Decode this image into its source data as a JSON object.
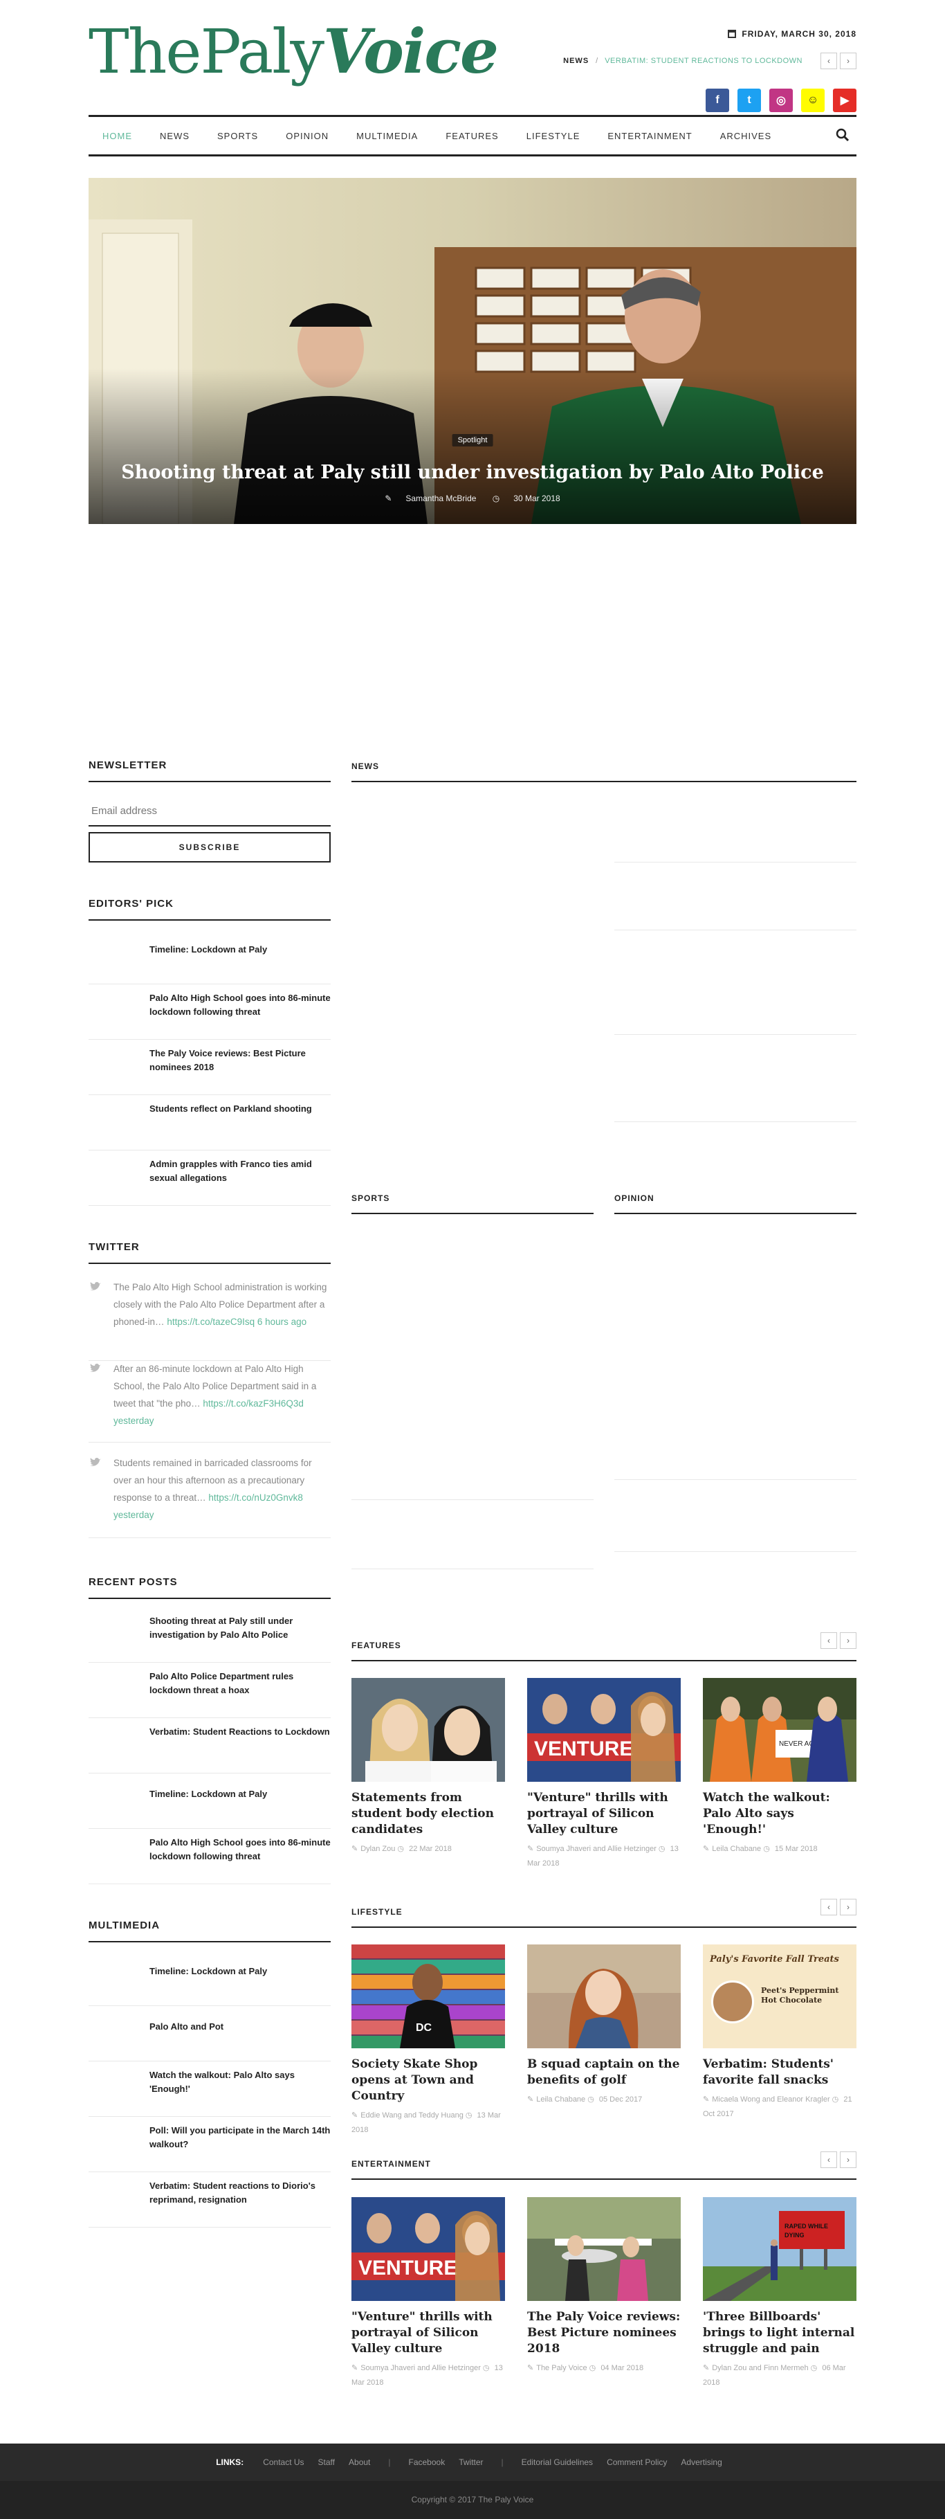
{
  "header": {
    "logo_part1": "ThePaly",
    "logo_part2": "Voice",
    "date": "FRIDAY, MARCH 30, 2018",
    "ticker_label": "NEWS",
    "ticker_sep": "/",
    "ticker_text": "VERBATIM: STUDENT REACTIONS TO LOCKDOWN",
    "prev": "‹",
    "next": "›",
    "socials": [
      {
        "name": "facebook-icon",
        "glyph": "f",
        "color": "#3b5998"
      },
      {
        "name": "twitter-icon",
        "glyph": "t",
        "color": "#1da1f2"
      },
      {
        "name": "instagram-icon",
        "glyph": "◎",
        "color": "#c13584"
      },
      {
        "name": "snapchat-icon",
        "glyph": "☺",
        "color": "#fffc00"
      },
      {
        "name": "youtube-icon",
        "glyph": "▶",
        "color": "#e52d27"
      }
    ]
  },
  "nav": [
    "HOME",
    "NEWS",
    "SPORTS",
    "OPINION",
    "MULTIMEDIA",
    "FEATURES",
    "LIFESTYLE",
    "ENTERTAINMENT",
    "ARCHIVES"
  ],
  "hero": {
    "tag": "Spotlight",
    "title": "Shooting threat at Paly still under investigation by Palo Alto Police",
    "author": "Samantha McBride",
    "date": "30 Mar 2018"
  },
  "newsletter": {
    "heading": "NEWSLETTER",
    "placeholder": "Email address",
    "button": "SUBSCRIBE"
  },
  "editors_pick": {
    "heading": "EDITORS' PICK",
    "items": [
      "Timeline: Lockdown at Paly",
      "Palo Alto High School goes into 86-minute lockdown following threat",
      "The Paly Voice reviews: Best Picture nominees 2018",
      "Students reflect on Parkland shooting",
      "Admin grapples with Franco ties amid sexual allegations"
    ]
  },
  "twitter": {
    "heading": "TWITTER",
    "tweets": [
      {
        "text": "The Palo Alto High School administration is working closely with the Palo Alto Police Department after a phoned-in…",
        "link": "https://t.co/tazeC9Isq",
        "time": "6 hours ago"
      },
      {
        "text": "After an 86-minute lockdown at Palo Alto High School, the Palo Alto Police Department said in a tweet that \"the pho…",
        "link": "https://t.co/kazF3H6Q3d",
        "time": "yesterday"
      },
      {
        "text": "Students remained in barricaded classrooms for over an hour this afternoon as a precautionary response to a threat…",
        "link": "https://t.co/nUz0Gnvk8",
        "time": "yesterday"
      }
    ]
  },
  "recent_posts": {
    "heading": "RECENT POSTS",
    "items": [
      "Shooting threat at Paly still under investigation by Palo Alto Police",
      "Palo Alto Police Department rules lockdown threat a hoax",
      "Verbatim: Student Reactions to Lockdown",
      "Timeline: Lockdown at Paly",
      "Palo Alto High School goes into 86-minute lockdown following threat"
    ]
  },
  "multimedia": {
    "heading": "MULTIMEDIA",
    "items": [
      "Timeline: Lockdown at Paly",
      "Palo Alto and Pot",
      "Watch the walkout: Palo Alto says 'Enough!'",
      "Poll: Will you participate in the March 14th walkout?",
      "Verbatim: Student reactions to Diorio's reprimand, resignation"
    ]
  },
  "sections": {
    "news": "NEWS",
    "sports": "SPORTS",
    "opinion": "OPINION",
    "features": "FEATURES",
    "lifestyle": "LIFESTYLE",
    "entertainment": "ENTERTAINMENT"
  },
  "features_cards": [
    {
      "title": "Statements from student body election candidates",
      "author": "Dylan Zou",
      "date": "22 Mar 2018"
    },
    {
      "title": "\"Venture\" thrills with portrayal of Silicon Valley culture",
      "author": "Soumya Jhaveri and Allie Hetzinger",
      "date": "13 Mar 2018"
    },
    {
      "title": "Watch the walkout: Palo Alto says 'Enough!'",
      "author": "Leila Chabane",
      "date": "15 Mar 2018"
    }
  ],
  "lifestyle_cards": [
    {
      "title": "Society Skate Shop opens at Town and Country",
      "author": "Eddie Wang and Teddy Huang",
      "date": "13 Mar 2018"
    },
    {
      "title": "B squad captain on the benefits of golf",
      "author": "Leila Chabane",
      "date": "05 Dec 2017"
    },
    {
      "title": "Verbatim: Students' favorite fall snacks",
      "author": "Micaela Wong and Eleanor Kragler",
      "date": "21 Oct 2017",
      "img_text": "Paly's Favorite Fall Treats",
      "img_sub": "Peet's Peppermint Hot Chocolate"
    }
  ],
  "entertainment_cards": [
    {
      "title": "\"Venture\" thrills with portrayal of Silicon Valley culture",
      "author": "Soumya Jhaveri and Allie Hetzinger",
      "date": "13 Mar 2018"
    },
    {
      "title": "The Paly Voice reviews: Best Picture nominees 2018",
      "author": "The Paly Voice",
      "date": "04 Mar 2018"
    },
    {
      "title": "'Three Billboards' brings to light internal struggle and pain",
      "author": "Dylan Zou and Finn Mermeh",
      "date": "06 Mar 2018"
    }
  ],
  "footer": {
    "links_label": "LINKS:",
    "links_a": [
      "Contact Us",
      "Staff",
      "About"
    ],
    "links_b": [
      "Facebook",
      "Twitter"
    ],
    "links_c": [
      "Editorial Guidelines",
      "Comment Policy",
      "Advertising"
    ],
    "copyright": "Copyright © 2017 The Paly Voice"
  }
}
